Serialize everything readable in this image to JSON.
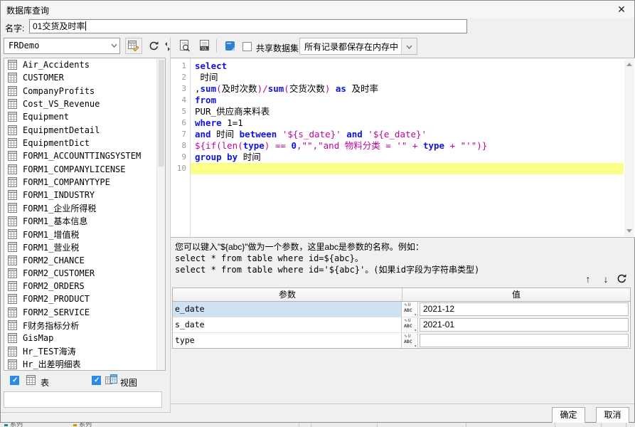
{
  "window": {
    "title": "数据库查询",
    "close_glyph": "✕"
  },
  "name_row": {
    "label": "名字:",
    "value": "01交货及时率"
  },
  "toolbar": {
    "connection_value": "FRDemo",
    "share_dataset_label": "共享数据集",
    "storage_mode_value": "所有记录都保存在内存中"
  },
  "left_panel": {
    "tables": [
      "Air_Accidents",
      "CUSTOMER",
      "CompanyProfits",
      "Cost_VS_Revenue",
      "Equipment",
      "EquipmentDetail",
      "EquipmentDict",
      "FORM1_ACCOUNTTINGSYSTEM",
      "FORM1_COMPANYLICENSE",
      "FORM1_COMPANYTYPE",
      "FORM1_INDUSTRY",
      "FORM1_企业所得税",
      "FORM1_基本信息",
      "FORM1_增值税",
      "FORM1_营业税",
      "FORM2_CHANCE",
      "FORM2_CUSTOMER",
      "FORM2_ORDERS",
      "FORM2_PRODUCT",
      "FORM2_SERVICE",
      "F财务指标分析",
      "GisMap",
      "Hr_TEST海涛",
      "Hr_出差明细表"
    ],
    "table_filter_label": "表",
    "view_filter_label": "视图"
  },
  "editor": {
    "lines": [
      {
        "tokens": [
          {
            "t": "select",
            "c": "k"
          }
        ]
      },
      {
        "tokens": [
          {
            "t": " 时间",
            "c": "p"
          }
        ]
      },
      {
        "tokens": [
          {
            "t": ",",
            "c": "p"
          },
          {
            "t": "sum",
            "c": "k"
          },
          {
            "t": "(",
            "c": "s"
          },
          {
            "t": "及时次数",
            "c": "p"
          },
          {
            "t": ")/",
            "c": "s"
          },
          {
            "t": "sum",
            "c": "k"
          },
          {
            "t": "(",
            "c": "s"
          },
          {
            "t": "交货次数",
            "c": "p"
          },
          {
            "t": ")",
            "c": "s"
          },
          {
            "t": " ",
            "c": "p"
          },
          {
            "t": "as",
            "c": "k"
          },
          {
            "t": " 及时率",
            "c": "p"
          }
        ]
      },
      {
        "tokens": [
          {
            "t": "from",
            "c": "k"
          }
        ]
      },
      {
        "tokens": [
          {
            "t": "PUR_供应商来料表",
            "c": "p"
          }
        ]
      },
      {
        "tokens": [
          {
            "t": "where",
            "c": "k"
          },
          {
            "t": " 1=1",
            "c": "p"
          }
        ]
      },
      {
        "tokens": [
          {
            "t": "and",
            "c": "k"
          },
          {
            "t": " 时间 ",
            "c": "p"
          },
          {
            "t": "between",
            "c": "k"
          },
          {
            "t": " ",
            "c": "p"
          },
          {
            "t": "'${s_date}'",
            "c": "s"
          },
          {
            "t": " ",
            "c": "p"
          },
          {
            "t": "and",
            "c": "k"
          },
          {
            "t": " ",
            "c": "p"
          },
          {
            "t": "'${e_date}'",
            "c": "s"
          }
        ]
      },
      {
        "tokens": [
          {
            "t": "${if(len(",
            "c": "s"
          },
          {
            "t": "type",
            "c": "k"
          },
          {
            "t": ") == ",
            "c": "s"
          },
          {
            "t": "0",
            "c": "k"
          },
          {
            "t": ",\"\",\"and 物料分类 = '\" + ",
            "c": "s"
          },
          {
            "t": "type",
            "c": "k"
          },
          {
            "t": " + \"'\")}",
            "c": "s"
          }
        ]
      },
      {
        "tokens": [
          {
            "t": "group by",
            "c": "k"
          },
          {
            "t": " 时间",
            "c": "p"
          }
        ]
      },
      {
        "tokens": [],
        "current": true
      }
    ]
  },
  "help": {
    "line1": "您可以键入\"${abc}\"做为一个参数，这里abc是参数的名称。例如：",
    "line2": "select * from table where id=${abc}。",
    "line3": "select * from table where id='${abc}'。(如果id字段为字符串类型)"
  },
  "params": {
    "col_param": "参数",
    "col_value": "值",
    "type_icon_top": "∿U",
    "type_icon_label": "ABC",
    "rows": [
      {
        "name": "e_date",
        "value": "2021-12",
        "selected": true
      },
      {
        "name": "s_date",
        "value": "2021-01",
        "selected": false
      },
      {
        "name": "type",
        "value": "",
        "selected": false
      }
    ]
  },
  "footer": {
    "ok_label": "确定",
    "cancel_label": "取消"
  },
  "background_strip": {
    "legend": [
      "系列",
      "系列"
    ]
  },
  "colors": {
    "keyword_blue": "#1212e0",
    "string_magenta": "#c4009b",
    "current_line_yellow": "#fcff87",
    "selected_row_blue": "#cfe2f4",
    "checkbox_blue": "#2b8be8",
    "dialog_bg": "#f0f0f0"
  }
}
